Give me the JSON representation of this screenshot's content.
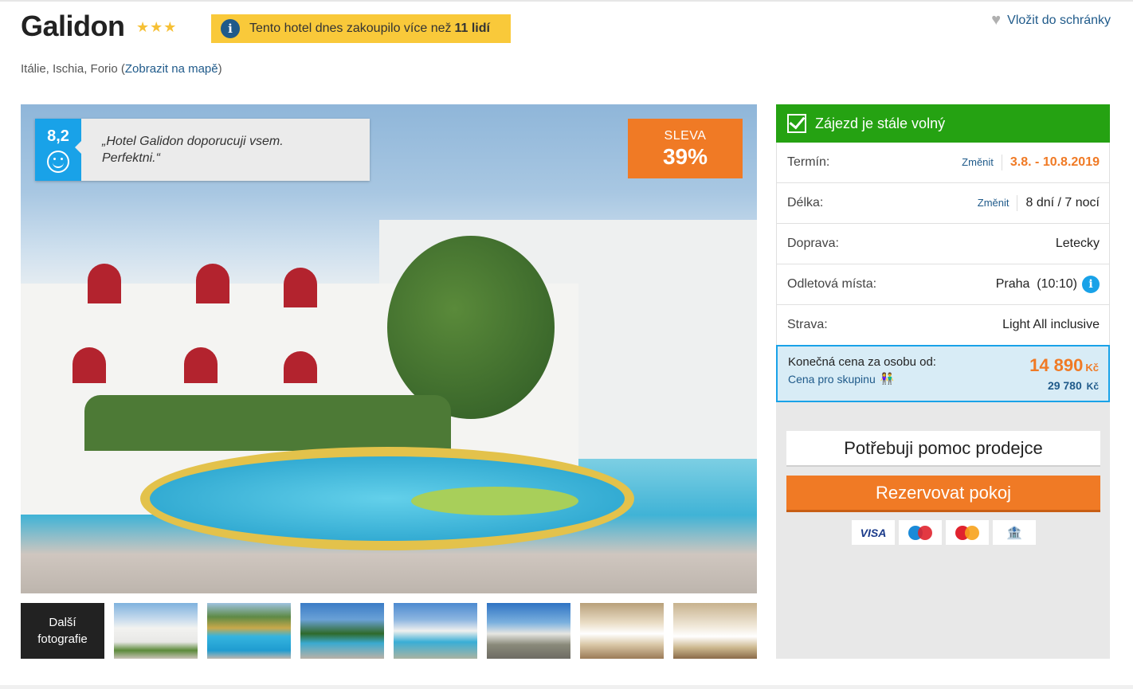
{
  "hotel": {
    "name": "Galidon",
    "stars": "★★★",
    "notice_text": "Tento hotel dnes zakoupilo více než",
    "notice_count": "11 lidí",
    "wishlist_label": "Vložit do schránky",
    "location_text": "Itálie, Ischia, Forio",
    "map_link": "Zobrazit na mapě"
  },
  "rating": {
    "score": "8,2",
    "quote_line1": "„Hotel Galidon doporucuji vsem.",
    "quote_line2": "Perfektni.“"
  },
  "sale": {
    "label": "SLEVA",
    "percent": "39%"
  },
  "gallery": {
    "more_label_1": "Další",
    "more_label_2": "fotografie",
    "thumbnail_count": 7
  },
  "booking": {
    "available_label": "Zájezd je stále volný",
    "rows": [
      {
        "label": "Termín:",
        "change": "Změnit",
        "value": "3.8. - 10.8.2019"
      },
      {
        "label": "Délka:",
        "change": "Změnit",
        "value": "8 dní / 7 nocí"
      },
      {
        "label": "Doprava:",
        "value": "Letecky"
      },
      {
        "label": "Odletová místa:",
        "value": "Praha  (10:10)"
      },
      {
        "label": "Strava:",
        "value": "Light All inclusive"
      }
    ],
    "price_label": "Konečná cena za osobu od:",
    "group_label": "Cena pro skupinu",
    "price_value": "14 890",
    "price_currency": "Kč",
    "group_value": "29 780",
    "group_currency": "Kč",
    "help_button": "Potřebuji pomoc prodejce",
    "book_button": "Rezervovat pokoj",
    "cards": {
      "visa": "VISA",
      "bank": "🏦"
    }
  },
  "colors": {
    "accent_orange": "#f07a25",
    "available_green": "#25a212",
    "rating_blue": "#19a2e8",
    "link_blue": "#1f5a8a",
    "notice_yellow": "#f9c93a"
  }
}
